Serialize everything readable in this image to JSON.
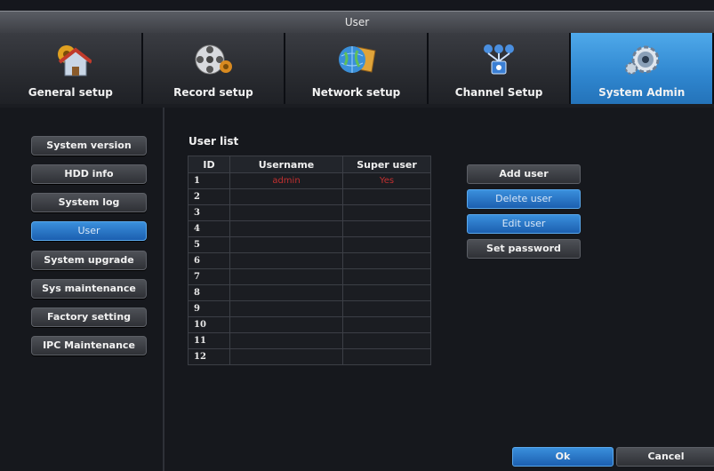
{
  "window": {
    "title": "User"
  },
  "tabs": [
    {
      "label": "General setup",
      "icon": "house-gear-icon"
    },
    {
      "label": "Record setup",
      "icon": "film-reel-icon"
    },
    {
      "label": "Network setup",
      "icon": "globe-laptop-icon"
    },
    {
      "label": "Channel Setup",
      "icon": "channel-network-icon"
    },
    {
      "label": "System Admin",
      "icon": "gear-icon"
    }
  ],
  "sidebar": {
    "items": [
      {
        "label": "System version"
      },
      {
        "label": "HDD info"
      },
      {
        "label": "System log"
      },
      {
        "label": "User"
      },
      {
        "label": "System upgrade"
      },
      {
        "label": "Sys maintenance"
      },
      {
        "label": "Factory setting"
      },
      {
        "label": "IPC Maintenance"
      }
    ]
  },
  "user_list": {
    "title": "User list",
    "columns": [
      "ID",
      "Username",
      "Super user"
    ],
    "rows": [
      [
        "1",
        "admin",
        "Yes"
      ],
      [
        "2",
        "",
        ""
      ],
      [
        "3",
        "",
        ""
      ],
      [
        "4",
        "",
        ""
      ],
      [
        "5",
        "",
        ""
      ],
      [
        "6",
        "",
        ""
      ],
      [
        "7",
        "",
        ""
      ],
      [
        "8",
        "",
        ""
      ],
      [
        "9",
        "",
        ""
      ],
      [
        "10",
        "",
        ""
      ],
      [
        "11",
        "",
        ""
      ],
      [
        "12",
        "",
        ""
      ]
    ]
  },
  "actions": {
    "add": "Add user",
    "delete": "Delete user",
    "edit": "Edit user",
    "password": "Set password"
  },
  "footer": {
    "ok": "Ok",
    "cancel": "Cancel"
  },
  "colors": {
    "accent": "#2f86cf",
    "highlight_text": "#c23030"
  }
}
